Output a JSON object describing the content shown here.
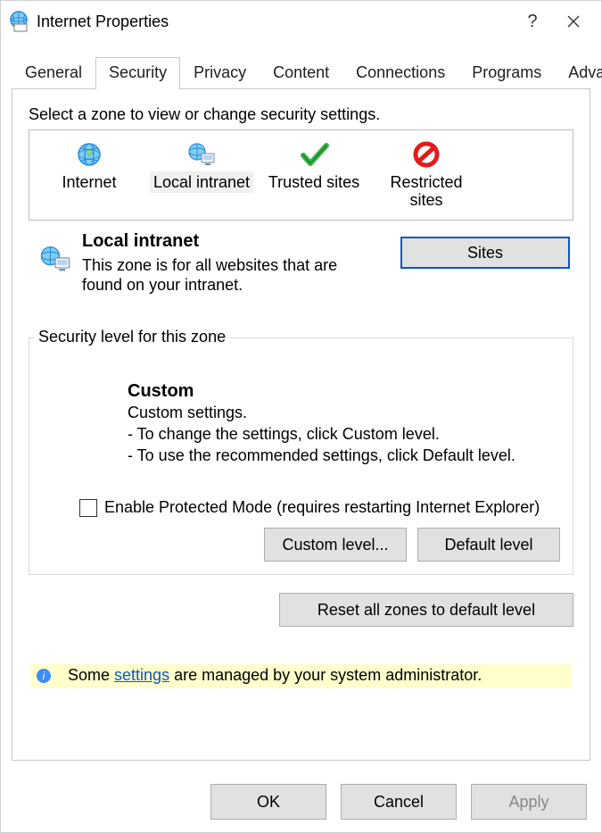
{
  "window_title": "Internet Properties",
  "tabs": [
    "General",
    "Security",
    "Privacy",
    "Content",
    "Connections",
    "Programs",
    "Advanced"
  ],
  "active_tab": "Security",
  "zone_instruction": "Select a zone to view or change security settings.",
  "zones": [
    {
      "label": "Internet",
      "icon": "globe"
    },
    {
      "label": "Local intranet",
      "icon": "intranet",
      "selected": true
    },
    {
      "label": "Trusted sites",
      "icon": "check"
    },
    {
      "label": "Restricted sites",
      "icon": "block"
    }
  ],
  "zone_detail": {
    "title": "Local intranet",
    "desc": "This zone is for all websites that are found on your intranet.",
    "sites_button": "Sites"
  },
  "group_legend": "Security level for this zone",
  "custom": {
    "title": "Custom",
    "line1": "Custom settings.",
    "line2": "- To change the settings, click Custom level.",
    "line3": "- To use the recommended settings, click Default level."
  },
  "protected_mode_label": "Enable Protected Mode (requires restarting Internet Explorer)",
  "protected_mode_checked": false,
  "custom_level_btn": "Custom level...",
  "default_level_btn": "Default level",
  "reset_btn": "Reset all zones to default level",
  "info_prefix": "Some ",
  "info_link": "settings",
  "info_suffix": " are managed by your system administrator.",
  "ok": "OK",
  "cancel": "Cancel",
  "apply": "Apply"
}
